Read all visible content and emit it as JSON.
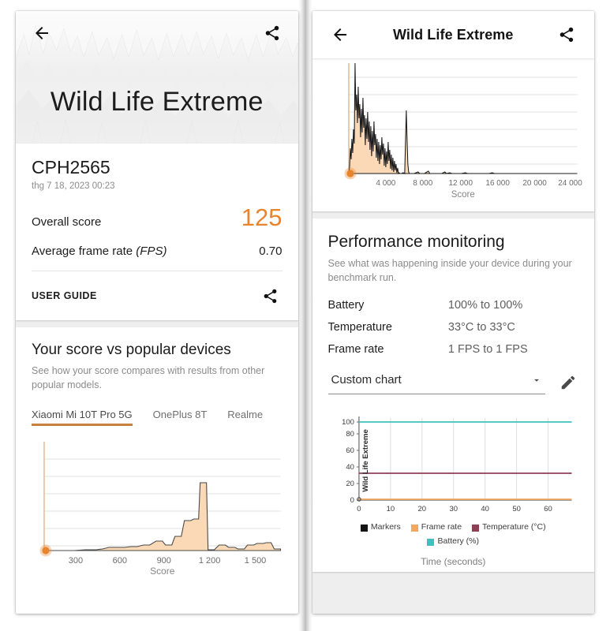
{
  "left_panel": {
    "header": {
      "back_icon": "arrow-left-icon",
      "share_icon": "share-icon",
      "title": "Wild Life Extreme"
    },
    "result_card": {
      "device_name": "CPH2565",
      "date": "thg 7 18, 2023 00:23",
      "overall_score_label": "Overall score",
      "overall_score_value": "125",
      "avg_frame_rate_label": "Average frame rate ",
      "avg_frame_rate_label_italic": "(FPS)",
      "avg_frame_rate_value": "0.70",
      "user_guide_label": "USER GUIDE",
      "share_icon": "share-icon"
    },
    "comparison_card": {
      "title": "Your score vs popular devices",
      "subtitle": "See how your score compares with results from other popular models.",
      "tabs": [
        {
          "label": "Xiaomi Mi 10T Pro 5G",
          "active": true
        },
        {
          "label": "OnePlus 8T",
          "active": false
        },
        {
          "label": "Realme",
          "active": false
        }
      ]
    }
  },
  "right_panel": {
    "appbar": {
      "back_icon": "arrow-left-icon",
      "title": "Wild Life Extreme",
      "share_icon": "share-icon"
    },
    "performance": {
      "title": "Performance monitoring",
      "subtitle": "See what was happening inside your device during your benchmark run.",
      "stats": [
        {
          "key": "Battery",
          "value": "100% to 100%"
        },
        {
          "key": "Temperature",
          "value": "33°C to 33°C"
        },
        {
          "key": "Frame rate",
          "value": "1 FPS to 1 FPS"
        }
      ],
      "chart_select_value": "Custom chart",
      "chart_select_icon": "chevron-down-icon",
      "edit_icon": "pencil-icon"
    }
  },
  "colors": {
    "accent_orange": "#E8842C",
    "tab_underline": "#C8803C",
    "area_fill": "#FBD9B6",
    "battery_teal": "#3FBFBF",
    "temperature_maroon": "#8E3F54",
    "frame_rate_orange": "#F2A860",
    "markers_black": "#141414"
  },
  "chart_data": [
    {
      "id": "left-distribution",
      "type": "area",
      "title": "",
      "xlabel": "Score",
      "ylabel": "",
      "xlim": [
        0,
        1700
      ],
      "ylim": [
        0,
        100
      ],
      "xticks": [
        "300",
        "600",
        "900",
        "1 200",
        "1 500"
      ],
      "xtick_values": [
        300,
        600,
        900,
        1200,
        1500
      ],
      "grid": true,
      "gridlines_y": 6,
      "marker": {
        "label": "Your score",
        "x": 125,
        "y": 0,
        "color": "#E8842C"
      },
      "x": [
        0,
        40,
        80,
        120,
        160,
        200,
        240,
        280,
        320,
        360,
        400,
        440,
        480,
        520,
        560,
        600,
        640,
        680,
        720,
        760,
        800,
        840,
        880,
        920,
        960,
        1000,
        1040,
        1080,
        1120,
        1160,
        1200,
        1240,
        1280,
        1320,
        1360,
        1400,
        1440,
        1480,
        1520,
        1560,
        1600,
        1640
      ],
      "values": [
        0,
        0,
        0,
        0,
        0,
        0,
        0,
        0,
        0,
        0,
        1,
        1,
        1,
        2,
        2,
        3,
        3,
        2,
        2,
        3,
        4,
        6,
        10,
        7,
        7,
        13,
        25,
        40,
        92,
        92,
        4,
        6,
        9,
        7,
        5,
        4,
        6,
        11,
        12,
        13,
        11,
        2
      ]
    },
    {
      "id": "right-distribution",
      "type": "area",
      "title": "",
      "xlabel": "Score",
      "ylabel": "",
      "xlim": [
        0,
        25500
      ],
      "ylim": [
        0,
        100
      ],
      "xticks": [
        "4 000",
        "8 000",
        "12 000",
        "16 000",
        "20 000",
        "24 000"
      ],
      "xtick_values": [
        4000,
        8000,
        12000,
        16000,
        20000,
        24000
      ],
      "grid": true,
      "gridlines_y": 6,
      "marker": {
        "label": "Your score",
        "x": 125,
        "y": 0,
        "color": "#E8842C"
      },
      "x": [
        0,
        250,
        500,
        750,
        1000,
        1250,
        1500,
        1750,
        2000,
        2250,
        2500,
        2750,
        3000,
        3250,
        3500,
        3750,
        4000,
        4250,
        4500,
        4750,
        5000,
        5250,
        5500,
        6000,
        6500,
        7000,
        7500,
        8000,
        9000,
        10000,
        11000,
        12000,
        14000,
        16000,
        18000,
        20000,
        22000,
        24000,
        25000
      ],
      "values": [
        4,
        22,
        18,
        100,
        28,
        38,
        55,
        30,
        48,
        24,
        42,
        20,
        38,
        18,
        30,
        14,
        26,
        10,
        6,
        4,
        40,
        6,
        3,
        2,
        3,
        5,
        2,
        1,
        1,
        3,
        1,
        1,
        1,
        1,
        1,
        1,
        0,
        0,
        0
      ]
    },
    {
      "id": "custom-chart",
      "type": "line",
      "title": "",
      "xlabel": "Time (seconds)",
      "ylabel": "Wild Life Extreme",
      "xlim": [
        0,
        63
      ],
      "ylim": [
        0,
        105
      ],
      "xticks": [
        "0",
        "10",
        "20",
        "30",
        "40",
        "50",
        "60"
      ],
      "xtick_values": [
        0,
        10,
        20,
        30,
        40,
        50,
        60
      ],
      "yticks": [
        "0",
        "20",
        "40",
        "60",
        "80",
        "100"
      ],
      "ytick_values": [
        0,
        20,
        40,
        60,
        80,
        100
      ],
      "grid": true,
      "legend_position": "bottom",
      "series": [
        {
          "name": "Markers",
          "color": "#141414",
          "constant": null,
          "values": []
        },
        {
          "name": "Frame rate",
          "color": "#F2A860",
          "constant": 1,
          "values": [
            1,
            1
          ]
        },
        {
          "name": "Temperature (°C)",
          "color": "#8E3F54",
          "constant": 33,
          "values": [
            33,
            33
          ]
        },
        {
          "name": "Battery (%)",
          "color": "#3FBFBF",
          "constant": 100,
          "values": [
            100,
            100
          ]
        }
      ]
    }
  ]
}
